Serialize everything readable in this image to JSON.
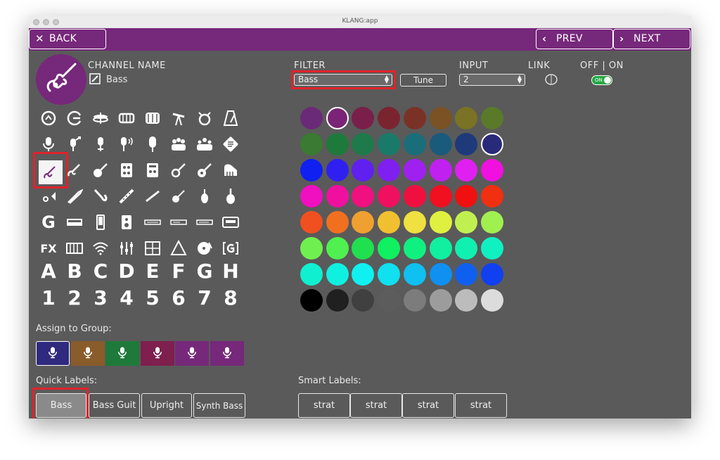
{
  "window": {
    "title": "KLANG:app"
  },
  "nav": {
    "back_label": "BACK",
    "prev_label": "PREV",
    "next_label": "NEXT"
  },
  "channel": {
    "heading": "CHANNEL NAME",
    "name": "Bass"
  },
  "filter": {
    "heading": "FILTER",
    "value": "Bass",
    "tune_label": "Tune"
  },
  "input": {
    "heading": "INPUT",
    "value": "2"
  },
  "link": {
    "heading": "LINK"
  },
  "onoff": {
    "heading": "OFF | ON",
    "state": "ON"
  },
  "groups": {
    "heading": "Assign to Group:",
    "items": [
      {
        "color": "#2f2a7d",
        "selected": true
      },
      {
        "color": "#8a5b2b",
        "selected": false
      },
      {
        "color": "#1e7a3a",
        "selected": false
      },
      {
        "color": "#7e1f4e",
        "selected": false
      },
      {
        "color": "#76287a",
        "selected": false
      },
      {
        "color": "#76287a",
        "selected": false
      }
    ]
  },
  "quick_labels": {
    "heading": "Quick Labels:",
    "items": [
      "Bass",
      "Bass Guit",
      "Upright",
      "Synth Bass"
    ]
  },
  "smart_labels": {
    "heading": "Smart Labels:",
    "items": [
      "strat",
      "strat",
      "strat",
      "strat"
    ]
  },
  "letters": [
    "A",
    "B",
    "C",
    "D",
    "E",
    "F",
    "G",
    "H"
  ],
  "numbers": [
    "1",
    "2",
    "3",
    "4",
    "5",
    "6",
    "7",
    "8"
  ],
  "icon_row6_fx": "FX",
  "icon_row5_g": "G",
  "palette": [
    [
      "#6b2a78",
      "#7b2477",
      "#7a1f4a",
      "#7a2430",
      "#7a3226",
      "#7a5224",
      "#7a7224",
      "#5a7a2a"
    ],
    [
      "#3a7a32",
      "#1e7a3a",
      "#1e7a4a",
      "#1a7a6a",
      "#1a6e7a",
      "#1a5a7a",
      "#1e3a7a",
      "#2a2a7a"
    ],
    [
      "#1020f0",
      "#3020f0",
      "#6020f0",
      "#8020f0",
      "#a020f0",
      "#c020f0",
      "#e020f0",
      "#f010e0"
    ],
    [
      "#f010c0",
      "#f010a0",
      "#f01080",
      "#f01060",
      "#f01040",
      "#f01020",
      "#f01010",
      "#f03010"
    ],
    [
      "#f05020",
      "#f07020",
      "#f0a030",
      "#f0c030",
      "#f0e040",
      "#e0f040",
      "#c0f050",
      "#a0f050"
    ],
    [
      "#70f050",
      "#50f050",
      "#20e050",
      "#10f060",
      "#10f080",
      "#10f0a0",
      "#10f0b0",
      "#10f0c0"
    ],
    [
      "#10f0d0",
      "#10f0e0",
      "#10f0f0",
      "#10e0f0",
      "#10c0f0",
      "#1090f0",
      "#1060f0",
      "#1040f0"
    ],
    [
      "#000000",
      "#202020",
      "#404040",
      "#5c5c5c",
      "#7c7c7c",
      "#9c9c9c",
      "#bcbcbc",
      "#dcdcdc"
    ]
  ],
  "palette_selected": [
    {
      "row": 0,
      "col": 1
    },
    {
      "row": 1,
      "col": 7
    }
  ]
}
